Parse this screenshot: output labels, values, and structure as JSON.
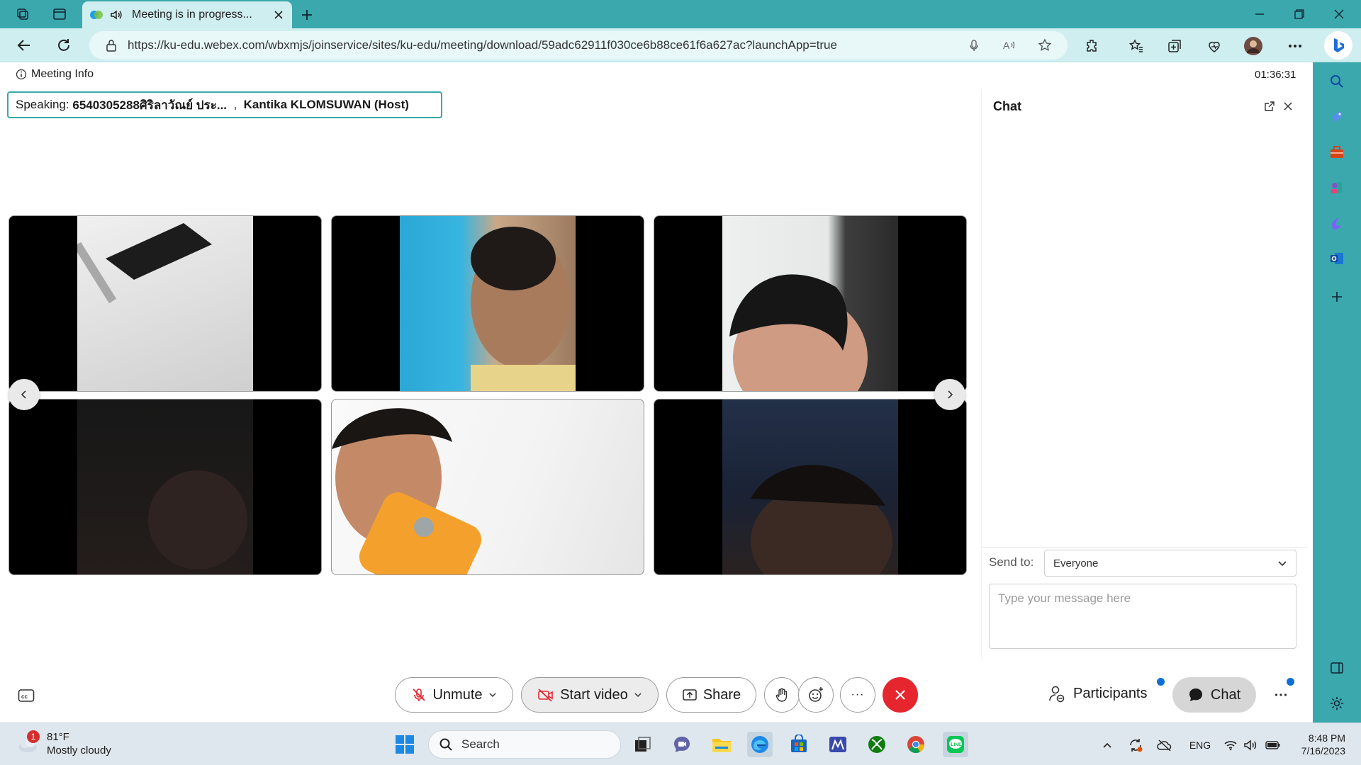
{
  "browser": {
    "tab_title": "Meeting is in progress...",
    "url": "https://ku-edu.webex.com/wbxmjs/joinservice/sites/ku-edu/meeting/download/59adc62911f030ce6b88ce61f6a627ac?launchApp=true"
  },
  "meeting": {
    "info_label": "Meeting Info",
    "timer": "01:36:31",
    "speaking_label": "Speaking:",
    "speaker_1": "6540305288ศิริลาวัณย์ ประ...",
    "separator": ",",
    "speaker_2": "Kantika KLOMSUWAN",
    "speaker_2_role": "(Host)"
  },
  "chat": {
    "title": "Chat",
    "send_to_label": "Send to:",
    "send_to_value": "Everyone",
    "input_placeholder": "Type your message here"
  },
  "controls": {
    "unmute": "Unmute",
    "start_video": "Start video",
    "share": "Share",
    "more": "···",
    "participants": "Participants",
    "chat": "Chat"
  },
  "taskbar": {
    "weather_temp": "81°F",
    "weather_desc": "Mostly cloudy",
    "weather_badge": "1",
    "search": "Search",
    "lang": "ENG",
    "time": "8:48 PM",
    "date": "7/16/2023"
  },
  "colors": {
    "chrome_teal": "#3aa8ad",
    "end_call_red": "#e5262f",
    "notification_blue": "#0b6fd6"
  }
}
